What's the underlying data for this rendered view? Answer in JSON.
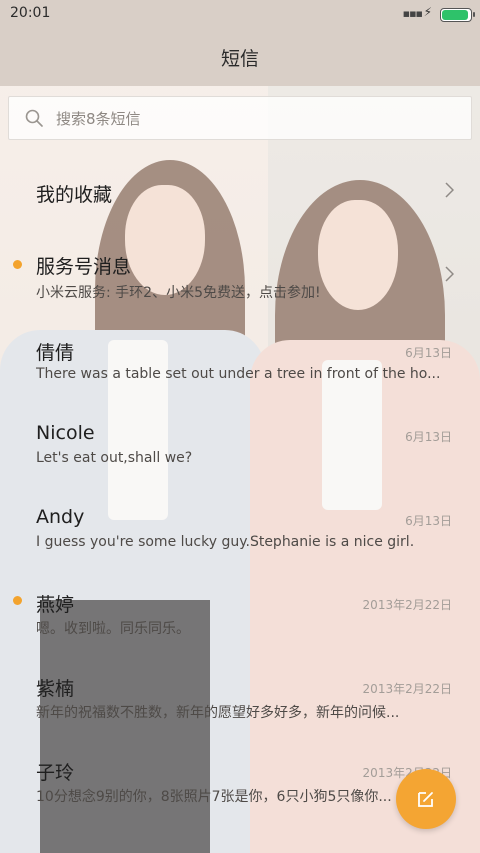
{
  "status_bar": {
    "time": "20:01",
    "battery_level": 1.0,
    "battery_color": "#2ec26a"
  },
  "header": {
    "title": "短信"
  },
  "search": {
    "placeholder": "搜索8条短信",
    "icon": "search-icon"
  },
  "list": {
    "favorites": {
      "label": "我的收藏"
    },
    "service": {
      "name": "服务号消息",
      "preview": "小米云服务: 手环2、小米5免费送，点击参加!",
      "unread": true
    },
    "conversations": [
      {
        "name": "倩倩",
        "date": "6月13日",
        "preview": "There was a table set out under a tree in front of the ho...",
        "unread": false
      },
      {
        "name": "Nicole",
        "date": "6月13日",
        "preview": "Let's eat out,shall we?",
        "unread": false
      },
      {
        "name": "Andy",
        "date": "6月13日",
        "preview": "I guess you're some lucky guy.Stephanie is a nice girl.",
        "unread": false
      },
      {
        "name": "燕婷",
        "date": "2013年2月22日",
        "preview": "嗯。收到啦。同乐同乐。",
        "unread": true
      },
      {
        "name": "紫楠",
        "date": "2013年2月22日",
        "preview": "新年的祝福数不胜数，新年的愿望好多好多，新年的问候...",
        "unread": false
      },
      {
        "name": "子玲",
        "date": "2013年2月22日",
        "preview": "10分想念9别的你，8张照片7张是你，6只小狗5只像你...",
        "unread": false
      }
    ]
  },
  "fab": {
    "icon": "compose-icon",
    "color": "#f4a533"
  },
  "colors": {
    "accent": "#f3a32d",
    "unread_dot": "#f3a32d"
  }
}
